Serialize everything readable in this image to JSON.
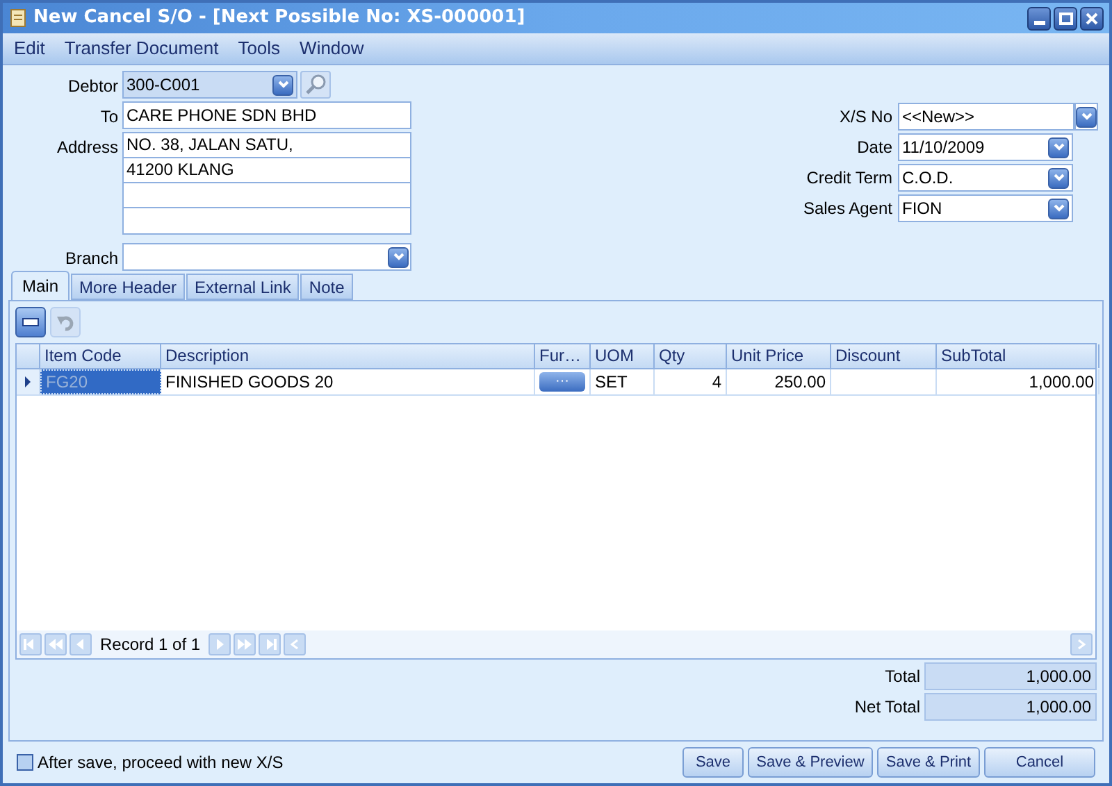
{
  "window": {
    "title": "New Cancel S/O - [Next Possible No: XS-000001]"
  },
  "menu": [
    "Edit",
    "Transfer Document",
    "Tools",
    "Window"
  ],
  "header_left": {
    "debtor": {
      "label": "Debtor",
      "value": "300-C001"
    },
    "to": {
      "label": "To",
      "value": "CARE PHONE SDN BHD"
    },
    "address": {
      "label": "Address",
      "lines": [
        "NO. 38, JALAN SATU,",
        "41200 KLANG"
      ]
    },
    "branch": {
      "label": "Branch"
    }
  },
  "header_right": [
    {
      "label": "X/S No",
      "value": "<<New>>",
      "kind": "wide"
    },
    {
      "label": "Date",
      "value": "11/10/2009",
      "kind": "dropdown"
    },
    {
      "label": "Credit Term",
      "value": "C.O.D.",
      "kind": "dropdown"
    },
    {
      "label": "Sales Agent",
      "value": "FION",
      "kind": "dropdown"
    }
  ],
  "tabs": [
    {
      "label": "Main",
      "selected": true
    },
    {
      "label": "More Header",
      "selected": false
    },
    {
      "label": "External Link",
      "selected": false
    },
    {
      "label": "Note",
      "selected": false
    }
  ],
  "toolbar": [
    {
      "kind": "remove",
      "disabled": false
    },
    {
      "kind": "undo",
      "disabled": true
    }
  ],
  "table": {
    "columns": [
      {
        "label": "Item Code",
        "kind": "text"
      },
      {
        "label": "Description",
        "kind": "text"
      },
      {
        "label": "Fur…",
        "kind": "button"
      },
      {
        "label": "UOM",
        "kind": "text"
      },
      {
        "label": "Qty",
        "kind": "number"
      },
      {
        "label": "Unit Price",
        "kind": "number"
      },
      {
        "label": "Discount",
        "kind": "number"
      },
      {
        "label": "SubTotal",
        "kind": "number"
      }
    ],
    "rows": [
      {
        "selected": true,
        "cells": [
          "FG20",
          "FINISHED GOODS 20",
          "···",
          "SET",
          "4",
          "250.00",
          "",
          "1,000.00"
        ]
      }
    ]
  },
  "navigator": {
    "text": "Record 1 of 1"
  },
  "totals": [
    {
      "label": "Total",
      "value": "1,000.00"
    },
    {
      "label": "Net Total",
      "value": "1,000.00"
    }
  ],
  "proceed_option": {
    "label": "After save, proceed with new X/S",
    "checked": false
  },
  "buttons": [
    "Save",
    "Save & Preview",
    "Save & Print",
    "Cancel"
  ]
}
